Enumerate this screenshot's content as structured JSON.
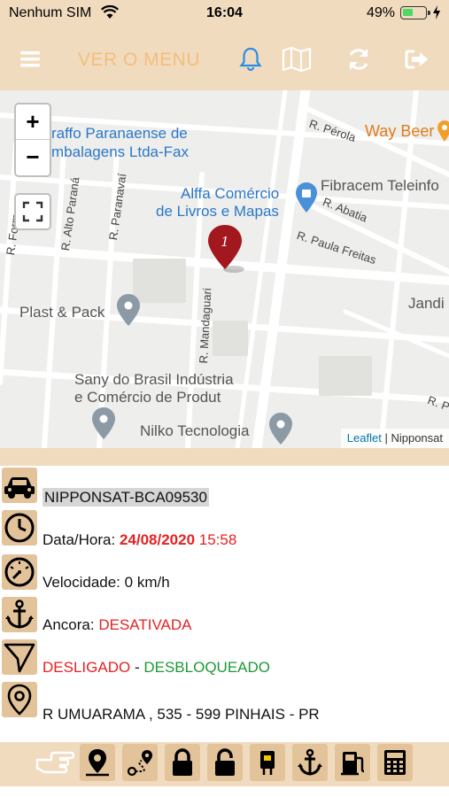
{
  "status_bar": {
    "carrier": "Nenhum SIM",
    "time": "16:04",
    "battery_percent": "49%",
    "battery_level": 0.49
  },
  "nav": {
    "menu_label": "VER O MENU",
    "icons": [
      "hamburger-icon",
      "bell-icon",
      "map-icon",
      "refresh-icon",
      "logout-icon"
    ],
    "accent_color": "#f3be7c",
    "bell_color": "#2a8ce6"
  },
  "map": {
    "zoom_in": "+",
    "zoom_out": "−",
    "marker_label": "1",
    "attribution_leaflet": "Leaflet",
    "attribution_sep": " | ",
    "attribution_provider": "Nipponsat",
    "places": {
      "graffo_1": "raffo Paranaense de",
      "graffo_2": "mbalagens Ltda-Fax",
      "way_beer": "Way Beer",
      "alffa_1": "Alffa Comércio",
      "alffa_2": "de Livros e Mapas",
      "fibracem": "Fibracem Teleinfo",
      "plast": "Plast & Pack",
      "jandi": "Jandi",
      "sany_1": "Sany do Brasil Indústria",
      "sany_2": "e Comércio de Produt",
      "nilko": "Nilko Tecnologia"
    },
    "streets": {
      "perola": "R. Pérola",
      "abatia": "R. Abatia",
      "paula_freitas": "R. Paula Freitas",
      "formosa": "R. Formosa",
      "alto_parana": "R. Alto Paraná",
      "paranavai": "R. Paranavaí",
      "mandaguari": "R. Mandaguari",
      "r_p": "R. P"
    }
  },
  "vehicle": {
    "plate": "NIPPONSAT-BCA09530",
    "datetime_label": "Data/Hora:",
    "date": "24/08/2020",
    "time": "15:58",
    "speed_label": "Velocidade:",
    "speed_value": "0 km/h",
    "anchor_label": "Ancora:",
    "anchor_value": "DESATIVADA",
    "ignition": "DESLIGADO",
    "separator": "-",
    "lock_status": "DESBLOQUEADO",
    "address": "R UMUARAMA , 535 - 599 PINHAIS - PR"
  },
  "toolbar": {
    "icons": [
      "pointing-hand-icon",
      "location-pin-icon",
      "route-icon",
      "lock-icon",
      "unlock-icon",
      "relay-icon",
      "anchor-icon",
      "fuel-icon",
      "calculator-icon"
    ]
  }
}
